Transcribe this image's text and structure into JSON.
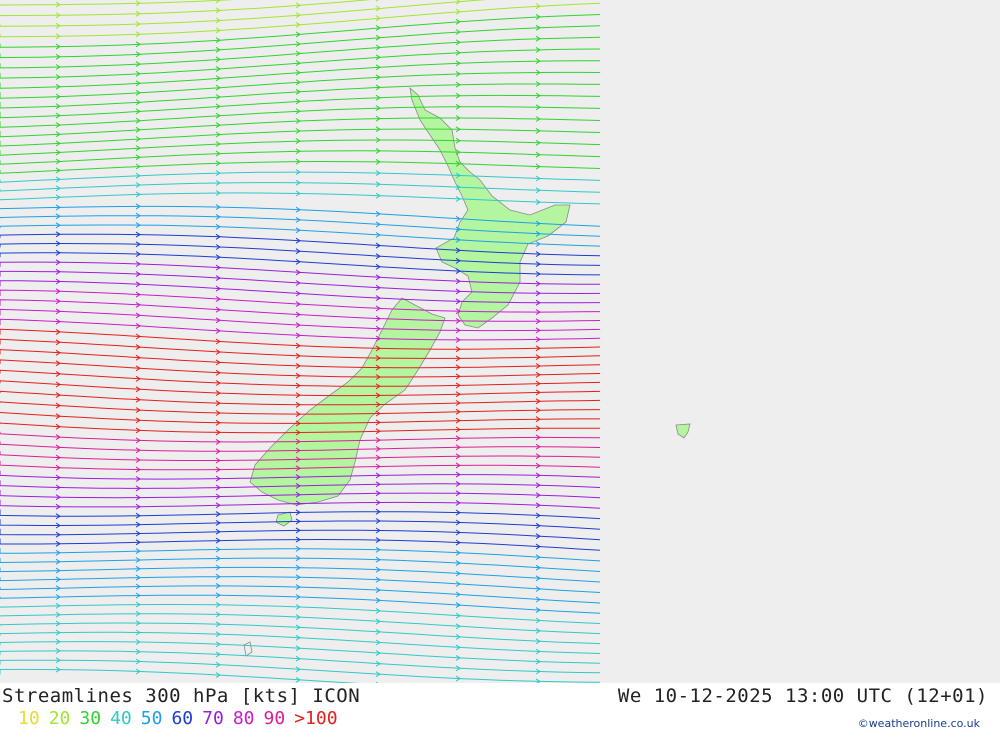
{
  "header": {
    "title": "Streamlines 300 hPa [kts] ICON",
    "valid_time": "We 10-12-2025 13:00 UTC (12+01)"
  },
  "legend": [
    {
      "label": "10",
      "color": "#e6dc32"
    },
    {
      "label": "20",
      "color": "#a0e632"
    },
    {
      "label": "30",
      "color": "#32d232"
    },
    {
      "label": "40",
      "color": "#32c8c8"
    },
    {
      "label": "50",
      "color": "#1ea0e6"
    },
    {
      "label": "60",
      "color": "#1e3cd2"
    },
    {
      "label": "70",
      "color": "#9b1edc"
    },
    {
      "label": "80",
      "color": "#c81ec8"
    },
    {
      "label": "90",
      "color": "#dc1e96"
    },
    {
      "label": ">100",
      "color": "#e61e1e"
    }
  ],
  "credit": "©weatheronline.co.uk",
  "colors": {
    "background": "#eeeeee",
    "land": "#b4f5a0",
    "coast": "#909090"
  }
}
